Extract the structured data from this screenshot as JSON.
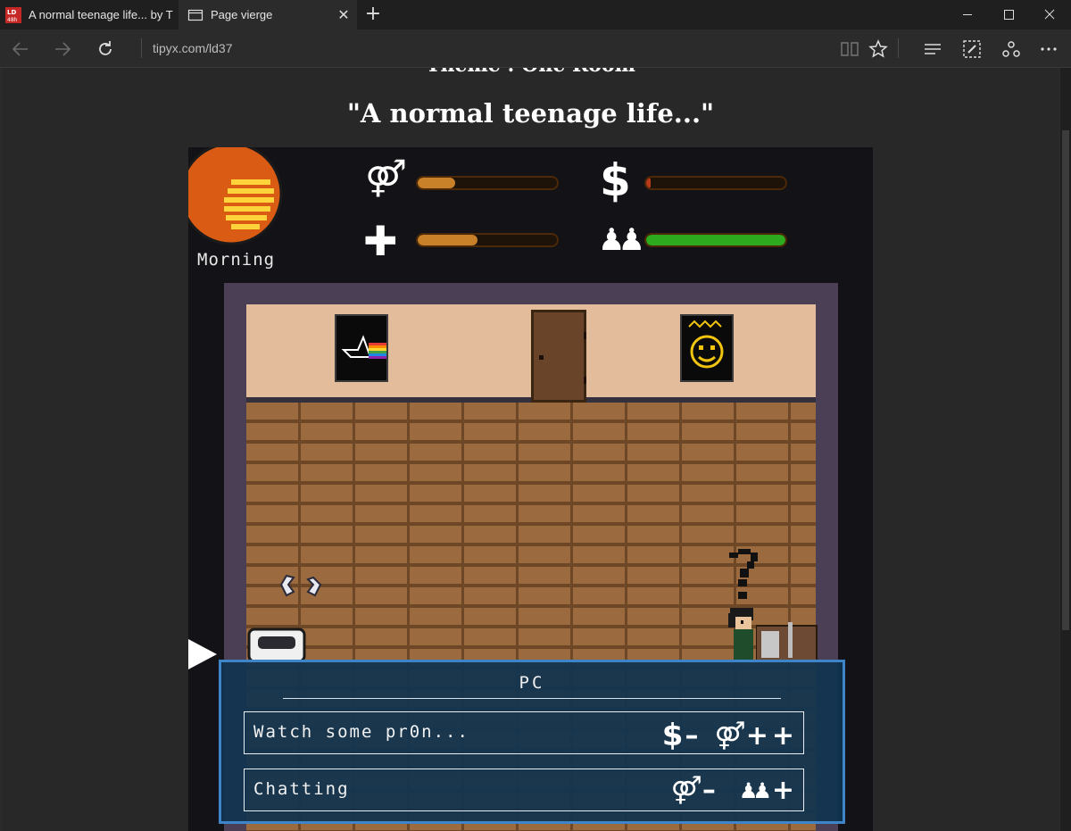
{
  "browser": {
    "tabs": [
      {
        "title": "A normal teenage life... by T",
        "active": true,
        "favicon": "ld48-favicon"
      },
      {
        "title": "Page vierge",
        "active": false,
        "favicon": "page-icon"
      }
    ],
    "address": "tipyx.com/ld37"
  },
  "page": {
    "theme": "Theme : One Room",
    "title": "\"A normal teenage life...\""
  },
  "hud": {
    "period": "Morning",
    "stats": [
      {
        "icon": "gender-icon",
        "symbol": "⚤",
        "level": 0.27,
        "color": "#c88128"
      },
      {
        "icon": "health-cross-icon",
        "symbol": "✚",
        "level": 0.43,
        "color": "#c88128"
      },
      {
        "icon": "money-icon",
        "symbol": "$",
        "level": 0.03,
        "color": "#b83a1a"
      },
      {
        "icon": "friends-icon",
        "symbol": "♟♟",
        "level": 1.0,
        "color": "#2eaa1e"
      }
    ]
  },
  "dialog": {
    "title": "PC",
    "options": [
      {
        "label": "Watch some pr0n...",
        "effects": [
          "$",
          "–",
          "⚤",
          "+",
          "+"
        ]
      },
      {
        "label": "Chatting",
        "effects": [
          "⚤",
          "–",
          "♟♟",
          "+"
        ]
      }
    ]
  },
  "scene": {
    "speech": "?"
  }
}
